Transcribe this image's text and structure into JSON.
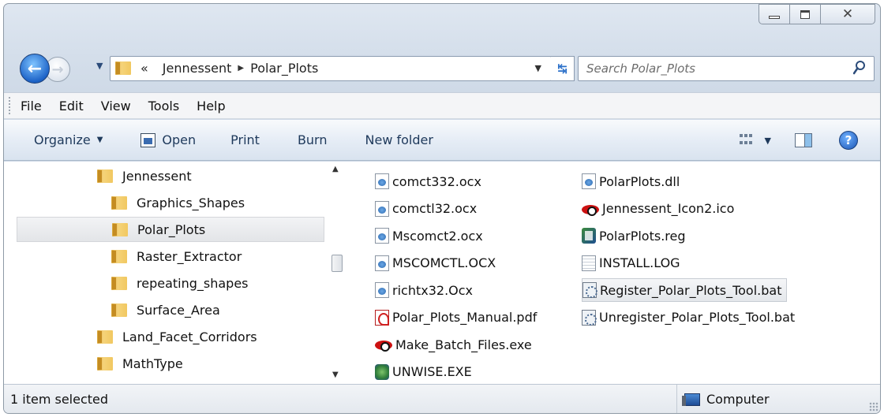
{
  "window": {
    "caption_buttons": {
      "minimize": "minimize",
      "maximize": "maximize",
      "close": "close"
    }
  },
  "address": {
    "overflow": "«",
    "crumbs": [
      "Jennessent",
      "Polar_Plots"
    ]
  },
  "search": {
    "placeholder": "Search Polar_Plots"
  },
  "menu": [
    "File",
    "Edit",
    "View",
    "Tools",
    "Help"
  ],
  "toolbar": {
    "organize": "Organize",
    "open": "Open",
    "print": "Print",
    "burn": "Burn",
    "new_folder": "New folder"
  },
  "tree": [
    {
      "label": "Jennessent",
      "level": 1,
      "selected": false
    },
    {
      "label": "Graphics_Shapes",
      "level": 2,
      "selected": false
    },
    {
      "label": "Polar_Plots",
      "level": 2,
      "selected": true
    },
    {
      "label": "Raster_Extractor",
      "level": 2,
      "selected": false
    },
    {
      "label": "repeating_shapes",
      "level": 2,
      "selected": false
    },
    {
      "label": "Surface_Area",
      "level": 2,
      "selected": false
    },
    {
      "label": "Land_Facet_Corridors",
      "level": 1,
      "selected": false
    },
    {
      "label": "MathType",
      "level": 1,
      "selected": false
    }
  ],
  "files": [
    {
      "name": "comct332.ocx",
      "icon": "doc"
    },
    {
      "name": "comctl32.ocx",
      "icon": "doc"
    },
    {
      "name": "Mscomct2.ocx",
      "icon": "doc"
    },
    {
      "name": "MSCOMCTL.OCX",
      "icon": "doc"
    },
    {
      "name": "richtx32.Ocx",
      "icon": "doc"
    },
    {
      "name": "Polar_Plots_Manual.pdf",
      "icon": "pdf"
    },
    {
      "name": "Make_Batch_Files.exe",
      "icon": "eye"
    },
    {
      "name": "UNWISE.EXE",
      "icon": "setup"
    },
    {
      "name": "PolarPlots.dll",
      "icon": "doc"
    },
    {
      "name": "Jennessent_Icon2.ico",
      "icon": "eye"
    },
    {
      "name": "PolarPlots.reg",
      "icon": "reg"
    },
    {
      "name": "INSTALL.LOG",
      "icon": "log"
    },
    {
      "name": "Register_Polar_Plots_Tool.bat",
      "icon": "bat",
      "selected": true
    },
    {
      "name": "Unregister_Polar_Plots_Tool.bat",
      "icon": "bat"
    }
  ],
  "status": {
    "selection": "1 item selected",
    "location": "Computer"
  }
}
